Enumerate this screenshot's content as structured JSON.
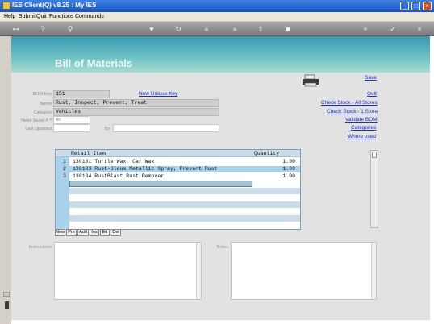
{
  "window": {
    "title": "IES Client(Q) v8.25 : My IES",
    "minimize_label": "_",
    "maximize_label": "□",
    "close_label": "×"
  },
  "menu": {
    "items": [
      "Help",
      "Submit",
      "Quit",
      "Functions",
      "Commands"
    ]
  },
  "toolbar": {
    "icons": [
      "key-icon",
      "help-icon",
      "search-icon",
      "heart-icon",
      "refresh-icon",
      "rewind-icon",
      "fast-forward-icon",
      "upload-icon",
      "stop-icon",
      "add-icon",
      "check-icon",
      "close-icon"
    ],
    "glyphs": [
      "⊶",
      "?",
      "⚲",
      "♥",
      "↻",
      "«",
      "»",
      "⇧",
      "■",
      "+",
      "✓",
      "×"
    ]
  },
  "page": {
    "title": "Bill of Materials"
  },
  "form": {
    "bom_key_label": "BOM Key",
    "bom_key_value": "151",
    "unique_key_link": "New Unique Key",
    "name_label": "Name",
    "name_value": "Rust, Inspect, Prevent, Treat",
    "category_label": "Category",
    "category_value": "Vehicles",
    "serial_label": "Need Serial # ?",
    "serial_value": "No",
    "last_updated_label": "Last Updated",
    "last_updated_value": "",
    "by_label": "By",
    "by_value": ""
  },
  "actions": {
    "save": "Save",
    "quit": "Quit",
    "check_stock_all": "Check Stock - All Stores",
    "check_stock_one": "Check Stock - 1 Store",
    "validate": "Validate BOM",
    "categories": "Categories",
    "where_used": "Where used"
  },
  "grid": {
    "columns": [
      "Retail Item",
      "Quantity"
    ],
    "rows": [
      {
        "num": "1",
        "item": "130101 Turtle Wax, Car Wax",
        "qty": "1.00"
      },
      {
        "num": "2",
        "item": "130103 Rust-Oleum Metallic Spray, Prevent Rust",
        "qty": "1.00"
      },
      {
        "num": "3",
        "item": "130104 RustBlast Rust Remover",
        "qty": "1.00"
      }
    ],
    "buttons": [
      "New",
      "Pre",
      "Add",
      "Ins",
      "Ed",
      "Del"
    ]
  },
  "memos": {
    "instructions_label": "Instructions",
    "notes_label": "Notes"
  },
  "colors": {
    "title_bar": "#1b54c4",
    "header_band": "#3a98b0",
    "link": "#1a2fd0",
    "grid_selection": "#a9d2ea"
  }
}
